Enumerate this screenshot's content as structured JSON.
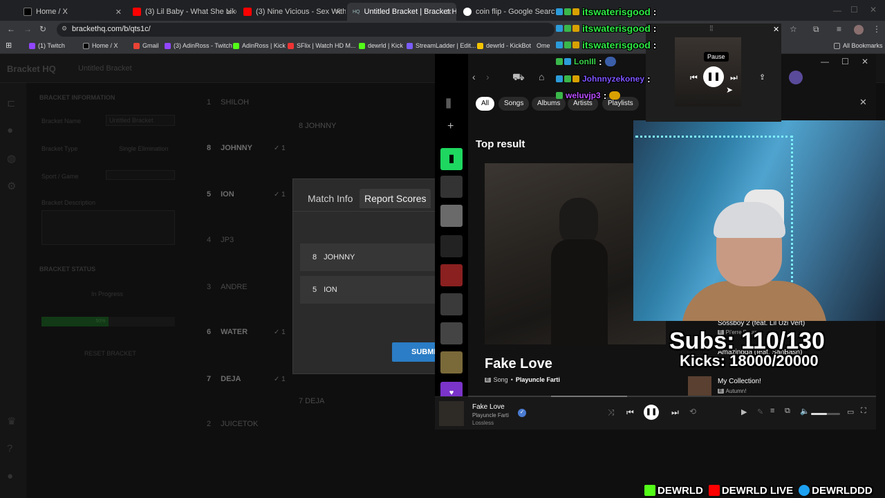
{
  "browser": {
    "tabs": [
      {
        "title": "Home / X",
        "fav": "#000000"
      },
      {
        "title": "(3) Lil Baby - What She Like - Yo",
        "fav": "#ff0000"
      },
      {
        "title": "(3) Nine Vicious - Sex With You",
        "fav": "#ff0000"
      },
      {
        "title": "Untitled Bracket | Bracket HQ",
        "fav": "#5b8fd6"
      },
      {
        "title": "coin flip - Google Search",
        "fav": "#4285f4"
      }
    ],
    "url": "brackethq.com/b/qts1c/",
    "bookmarks": [
      {
        "label": "(1) Twitch",
        "color": "#9146ff"
      },
      {
        "label": "Home / X",
        "color": "#000000"
      },
      {
        "label": "Gmail",
        "color": "#ea4335"
      },
      {
        "label": "(3) AdinRoss - Twitch",
        "color": "#9146ff"
      },
      {
        "label": "AdinRoss | Kick",
        "color": "#53fc18"
      },
      {
        "label": "SFlix | Watch HD M...",
        "color": "#e33"
      },
      {
        "label": "dewrld | Kick",
        "color": "#53fc18"
      },
      {
        "label": "StreamLadder | Edit...",
        "color": "#7a5cff"
      },
      {
        "label": "dewrld - KickBot",
        "color": "#f5c400"
      },
      {
        "label": "Ome",
        "color": "#888888"
      }
    ],
    "all_bookmarks": "All Bookmarks"
  },
  "bracket": {
    "brand": "Bracket HQ",
    "doc_title": "Untitled Bracket",
    "info_heading": "BRACKET INFORMATION",
    "name_label": "Bracket Name",
    "name_value": "Untitled Bracket",
    "type_label": "Bracket Type",
    "type_value": "Single Elimination",
    "sport_label": "Sport / Game",
    "desc_label": "Bracket Description",
    "status_heading": "BRACKET STATUS",
    "status_value": "In Progress",
    "progress_label": "50%",
    "progress": 0.5,
    "reset": "RESET BRACKET",
    "seeds": [
      {
        "seed": "1",
        "name": "SHILOH"
      },
      {
        "seed": "8",
        "name": "JOHNNY",
        "win": "1"
      },
      {
        "seed": "5",
        "name": "ION",
        "win": "1"
      },
      {
        "seed": "4",
        "name": "JP3"
      },
      {
        "seed": "3",
        "name": "ANDRE"
      },
      {
        "seed": "6",
        "name": "WATER",
        "win": "1"
      },
      {
        "seed": "7",
        "name": "DEJA",
        "win": "1"
      },
      {
        "seed": "2",
        "name": "JUICETOK"
      }
    ],
    "r2_a": "8  JOHNNY",
    "r2_b": "7  DEJA"
  },
  "modal": {
    "tab_info": "Match Info",
    "tab_scores": "Report Scores",
    "team1_seed": "8",
    "team1_name": "JOHNNY",
    "team2_seed": "5",
    "team2_name": "ION",
    "submit": "SUBMI"
  },
  "spotify": {
    "filters": [
      "All",
      "Songs",
      "Albums",
      "Artists",
      "Playlists"
    ],
    "top_result": "Top result",
    "song": "Fake Love",
    "song_type": "Song",
    "artist": "Playuncle Farti",
    "side": [
      {
        "title": "Sossboy 2 (feat. Lil Uzi Vert)",
        "sub": "Pi'erre Bourne"
      },
      {
        "title": "Amazingga (feat. SanBash)",
        "sub": ""
      },
      {
        "title": "My Collection!",
        "sub": "Autumn!"
      }
    ],
    "now_title": "Fake Love",
    "now_artist": "Playuncle Farti",
    "now_quality": "Lossless",
    "volume": 0.55
  },
  "mini_player": {
    "tooltip": "Pause"
  },
  "chat": [
    {
      "user": "itswaterisgood",
      "color": "#2ee845"
    },
    {
      "user": "itswaterisgood",
      "color": "#2ee845"
    },
    {
      "user": "itswaterisgood",
      "color": "#2ee845"
    },
    {
      "user": "LonIII",
      "color": "#3ad24a"
    },
    {
      "user": "Johnnyzekoney",
      "color": "#7e54ff"
    },
    {
      "user": "weluvjp3",
      "color": "#b84dff"
    }
  ],
  "overlay": {
    "subs": "Subs: 110/130",
    "kicks": "Kicks: 18000/20000"
  },
  "social": [
    "DEWRLD",
    "DEWRLD LIVE",
    "DEWRLDDD"
  ]
}
